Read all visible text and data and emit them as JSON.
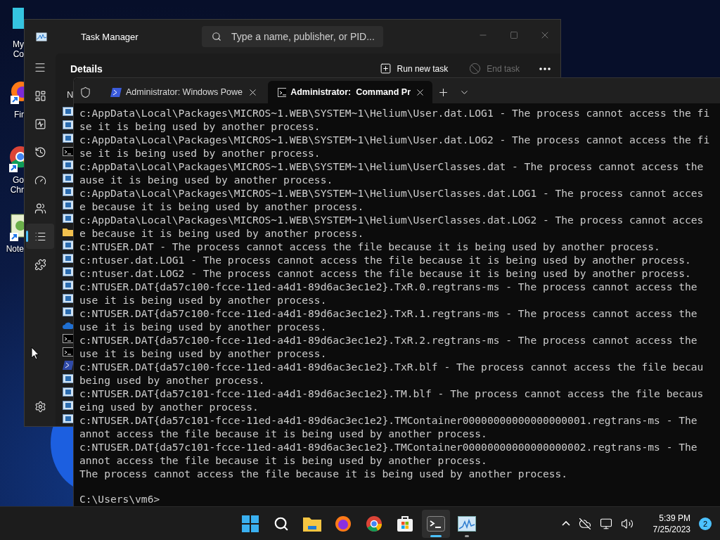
{
  "desktop_icons": [
    {
      "kind": "computer",
      "label": "My Co"
    },
    {
      "kind": "firefox",
      "label": "Fir"
    },
    {
      "kind": "chrome",
      "label": "Go Chr"
    },
    {
      "kind": "notepad",
      "label": "Note"
    }
  ],
  "task_manager": {
    "title": "Task Manager",
    "search": {
      "placeholder": "Type a name, publisher, or PID..."
    },
    "nav": [
      {
        "kind": "processes",
        "selected": false
      },
      {
        "kind": "performance",
        "selected": false
      },
      {
        "kind": "history",
        "selected": false
      },
      {
        "kind": "startup",
        "selected": false
      },
      {
        "kind": "users",
        "selected": false
      },
      {
        "kind": "details",
        "selected": true
      },
      {
        "kind": "services",
        "selected": false
      }
    ],
    "page_title": "Details",
    "actions": [
      {
        "kind": "run",
        "label": "Run new task",
        "disabled": false
      },
      {
        "kind": "end",
        "label": "End task",
        "disabled": true
      }
    ],
    "column_header": "N",
    "process_rows": [
      {
        "kind": "app"
      },
      {
        "kind": "app"
      },
      {
        "kind": "app"
      },
      {
        "kind": "cmd"
      },
      {
        "kind": "app"
      },
      {
        "kind": "app"
      },
      {
        "kind": "app"
      },
      {
        "kind": "app"
      },
      {
        "kind": "app"
      },
      {
        "kind": "folder"
      },
      {
        "kind": "app"
      },
      {
        "kind": "app"
      },
      {
        "kind": "app"
      },
      {
        "kind": "app"
      },
      {
        "kind": "app"
      },
      {
        "kind": "app"
      },
      {
        "kind": "cloud"
      },
      {
        "kind": "cmd"
      },
      {
        "kind": "cmd"
      },
      {
        "kind": "powershell"
      },
      {
        "kind": "app"
      },
      {
        "kind": "app"
      },
      {
        "kind": "app"
      },
      {
        "kind": "app"
      }
    ]
  },
  "terminal": {
    "tabs": [
      {
        "kind": "powershell",
        "title": "Administrator: Windows Powe",
        "selected": false
      },
      {
        "kind": "cmd",
        "title": "Administrator:  Command Pr",
        "selected": true
      }
    ],
    "lines": [
      "c:AppData\\Local\\Packages\\MICROS~1.WEB\\SYSTEM~1\\Helium\\User.dat.LOG1 - The process cannot access the fi",
      "se it is being used by another process.",
      "c:AppData\\Local\\Packages\\MICROS~1.WEB\\SYSTEM~1\\Helium\\User.dat.LOG2 - The process cannot access the fi",
      "se it is being used by another process.",
      "c:AppData\\Local\\Packages\\MICROS~1.WEB\\SYSTEM~1\\Helium\\UserClasses.dat - The process cannot access the",
      "ause it is being used by another process.",
      "c:AppData\\Local\\Packages\\MICROS~1.WEB\\SYSTEM~1\\Helium\\UserClasses.dat.LOG1 - The process cannot acces",
      "e because it is being used by another process.",
      "c:AppData\\Local\\Packages\\MICROS~1.WEB\\SYSTEM~1\\Helium\\UserClasses.dat.LOG2 - The process cannot acces",
      "e because it is being used by another process.",
      "c:NTUSER.DAT - The process cannot access the file because it is being used by another process.",
      "c:ntuser.dat.LOG1 - The process cannot access the file because it is being used by another process.",
      "c:ntuser.dat.LOG2 - The process cannot access the file because it is being used by another process.",
      "c:NTUSER.DAT{da57c100-fcce-11ed-a4d1-89d6ac3ec1e2}.TxR.0.regtrans-ms - The process cannot access the",
      "use it is being used by another process.",
      "c:NTUSER.DAT{da57c100-fcce-11ed-a4d1-89d6ac3ec1e2}.TxR.1.regtrans-ms - The process cannot access the",
      "use it is being used by another process.",
      "c:NTUSER.DAT{da57c100-fcce-11ed-a4d1-89d6ac3ec1e2}.TxR.2.regtrans-ms - The process cannot access the",
      "use it is being used by another process.",
      "c:NTUSER.DAT{da57c100-fcce-11ed-a4d1-89d6ac3ec1e2}.TxR.blf - The process cannot access the file becau",
      "being used by another process.",
      "c:NTUSER.DAT{da57c101-fcce-11ed-a4d1-89d6ac3ec1e2}.TM.blf - The process cannot access the file becaus",
      "eing used by another process.",
      "c:NTUSER.DAT{da57c101-fcce-11ed-a4d1-89d6ac3ec1e2}.TMContainer00000000000000000001.regtrans-ms - The",
      "annot access the file because it is being used by another process.",
      "c:NTUSER.DAT{da57c101-fcce-11ed-a4d1-89d6ac3ec1e2}.TMContainer00000000000000000002.regtrans-ms - The",
      "annot access the file because it is being used by another process.",
      "The process cannot access the file because it is being used by another process."
    ],
    "prompt": "C:\\Users\\vm6>"
  },
  "taskbar": {
    "apps": [
      {
        "kind": "start",
        "running": false,
        "active": false
      },
      {
        "kind": "search",
        "running": false,
        "active": false
      },
      {
        "kind": "explorer",
        "running": false,
        "active": false
      },
      {
        "kind": "firefox",
        "running": false,
        "active": false
      },
      {
        "kind": "chrome",
        "running": false,
        "active": false
      },
      {
        "kind": "store",
        "running": false,
        "active": false
      },
      {
        "kind": "terminal",
        "running": true,
        "active": true
      },
      {
        "kind": "taskmanager",
        "running": true,
        "active": false
      }
    ],
    "time": "5:39 PM",
    "date": "7/25/2023",
    "notifications": "2"
  }
}
